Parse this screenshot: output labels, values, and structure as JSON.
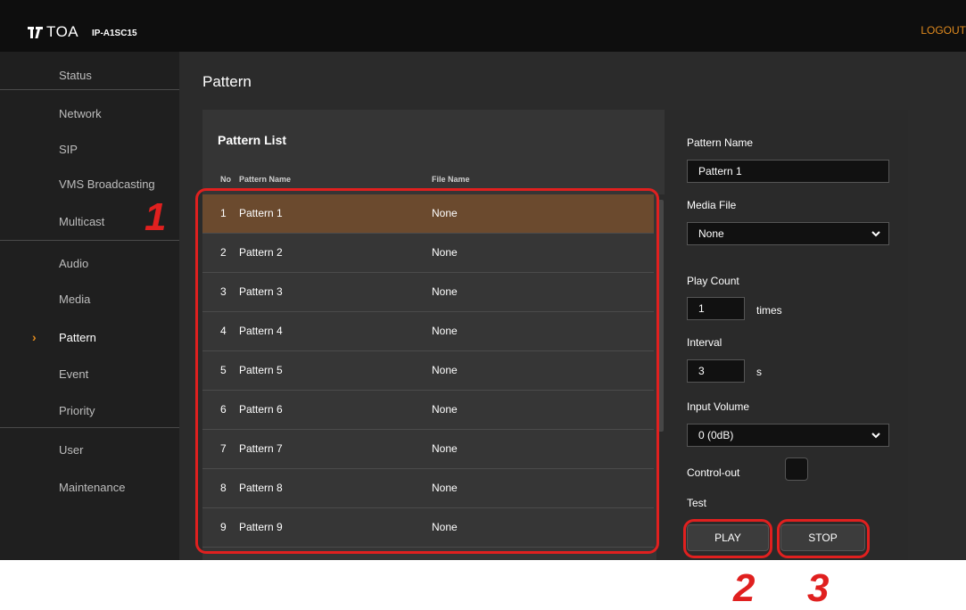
{
  "header": {
    "brand": "TOA",
    "model": "IP-A1SC15",
    "logout_label": "LOGOUT"
  },
  "sidebar": {
    "items": [
      {
        "label": "Status"
      },
      {
        "label": "Network"
      },
      {
        "label": "SIP"
      },
      {
        "label": "VMS Broadcasting"
      },
      {
        "label": "Multicast"
      },
      {
        "label": "Audio"
      },
      {
        "label": "Media"
      },
      {
        "label": "Pattern",
        "active": true
      },
      {
        "label": "Event"
      },
      {
        "label": "Priority"
      },
      {
        "label": "User"
      },
      {
        "label": "Maintenance"
      }
    ],
    "active_marker": "›"
  },
  "page": {
    "title": "Pattern"
  },
  "pattern_list": {
    "title": "Pattern List",
    "columns": {
      "no": "No",
      "name": "Pattern Name",
      "file": "File Name"
    },
    "rows": [
      {
        "no": "1",
        "name": "Pattern 1",
        "file": "None",
        "selected": true
      },
      {
        "no": "2",
        "name": "Pattern 2",
        "file": "None"
      },
      {
        "no": "3",
        "name": "Pattern 3",
        "file": "None"
      },
      {
        "no": "4",
        "name": "Pattern 4",
        "file": "None"
      },
      {
        "no": "5",
        "name": "Pattern 5",
        "file": "None"
      },
      {
        "no": "6",
        "name": "Pattern 6",
        "file": "None"
      },
      {
        "no": "7",
        "name": "Pattern 7",
        "file": "None"
      },
      {
        "no": "8",
        "name": "Pattern 8",
        "file": "None"
      },
      {
        "no": "9",
        "name": "Pattern 9",
        "file": "None"
      }
    ]
  },
  "settings": {
    "pattern_name_label": "Pattern Name",
    "pattern_name_value": "Pattern 1",
    "media_file_label": "Media File",
    "media_file_value": "None",
    "play_count_label": "Play Count",
    "play_count_value": "1",
    "play_count_unit": "times",
    "interval_label": "Interval",
    "interval_value": "3",
    "interval_unit": "s",
    "input_volume_label": "Input Volume",
    "input_volume_value": "0 (0dB)",
    "control_out_label": "Control-out",
    "test_label": "Test",
    "play_label": "PLAY",
    "stop_label": "STOP"
  },
  "callouts": [
    "1",
    "2",
    "3"
  ],
  "colors": {
    "accent": "#e08a1e",
    "selected_row": "#6b4a2e",
    "callout": "#e0201f"
  }
}
